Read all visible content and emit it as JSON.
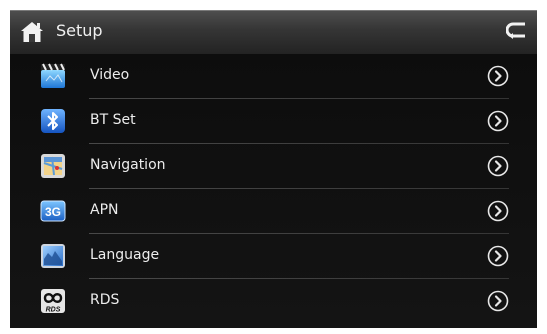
{
  "header": {
    "title": "Setup",
    "home_icon": "home-icon",
    "back_icon": "back-icon"
  },
  "menu": {
    "items": [
      {
        "label": "Video",
        "icon": "video-icon"
      },
      {
        "label": "BT Set",
        "icon": "bluetooth-icon"
      },
      {
        "label": "Navigation",
        "icon": "navigation-icon"
      },
      {
        "label": "APN",
        "icon": "3g-icon",
        "icon_text": "3G"
      },
      {
        "label": "Language",
        "icon": "language-icon"
      },
      {
        "label": "RDS",
        "icon": "rds-icon",
        "icon_text": "RDS"
      }
    ],
    "arrow_icon": "chevron-right-icon"
  },
  "colors": {
    "background": "#0f0f0f",
    "header_top": "#4f4f4f",
    "text": "#ededed"
  }
}
